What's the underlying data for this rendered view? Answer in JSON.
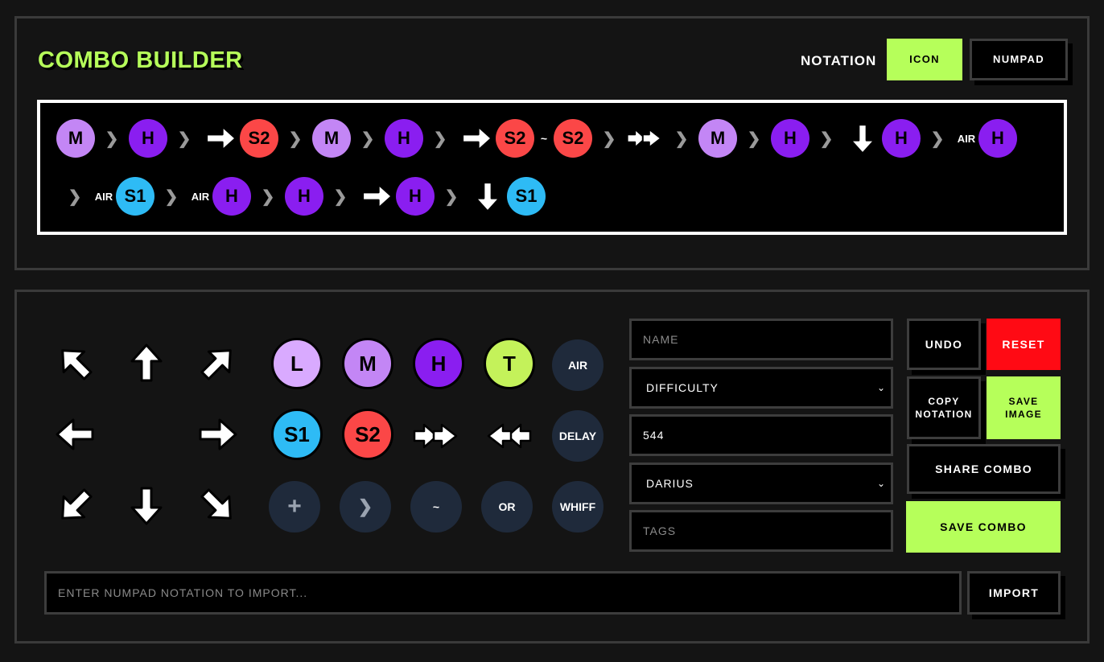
{
  "header": {
    "title": "COMBO BUILDER",
    "notation_label": "NOTATION",
    "notation_options": [
      "ICON",
      "NUMPAD"
    ],
    "notation_selected": "ICON"
  },
  "colors": {
    "accent": "#b6ff5a",
    "reset": "#ff0a14",
    "light": "#d9aaff",
    "medium": "#c386f5",
    "heavy": "#8a1ef0",
    "special1": "#2ebbf5",
    "special2": "#fb4747",
    "tag": "#c4f25a",
    "modifier_bg": "#1f2a3b"
  },
  "combo": {
    "row1": [
      {
        "t": "btn",
        "v": "M"
      },
      {
        "t": "sep",
        "v": "❯"
      },
      {
        "t": "btn",
        "v": "H"
      },
      {
        "t": "sep",
        "v": "❯"
      },
      {
        "t": "dir",
        "v": "right"
      },
      {
        "t": "btn",
        "v": "S2"
      },
      {
        "t": "sep",
        "v": "❯"
      },
      {
        "t": "btn",
        "v": "M"
      },
      {
        "t": "sep",
        "v": "❯"
      },
      {
        "t": "btn",
        "v": "H"
      },
      {
        "t": "sep",
        "v": "❯"
      },
      {
        "t": "dir",
        "v": "right"
      },
      {
        "t": "btn",
        "v": "S2"
      },
      {
        "t": "tilde",
        "v": "~"
      },
      {
        "t": "btn",
        "v": "S2"
      },
      {
        "t": "sep",
        "v": "❯"
      },
      {
        "t": "dir",
        "v": "dash-forward"
      },
      {
        "t": "sep",
        "v": "❯"
      },
      {
        "t": "btn",
        "v": "M"
      },
      {
        "t": "sep",
        "v": "❯"
      },
      {
        "t": "btn",
        "v": "H"
      },
      {
        "t": "sep",
        "v": "❯"
      },
      {
        "t": "dir",
        "v": "down"
      },
      {
        "t": "btn",
        "v": "H"
      },
      {
        "t": "sep",
        "v": "❯"
      },
      {
        "t": "air",
        "v": "AIR"
      },
      {
        "t": "btn",
        "v": "H"
      }
    ],
    "row2": [
      {
        "t": "sep",
        "v": "❯"
      },
      {
        "t": "air",
        "v": "AIR"
      },
      {
        "t": "btn",
        "v": "S1"
      },
      {
        "t": "sep",
        "v": "❯"
      },
      {
        "t": "air",
        "v": "AIR"
      },
      {
        "t": "btn",
        "v": "H"
      },
      {
        "t": "sep",
        "v": "❯"
      },
      {
        "t": "btn",
        "v": "H"
      },
      {
        "t": "sep",
        "v": "❯"
      },
      {
        "t": "dir",
        "v": "right"
      },
      {
        "t": "btn",
        "v": "H"
      },
      {
        "t": "sep",
        "v": "❯"
      },
      {
        "t": "dir",
        "v": "down"
      },
      {
        "t": "btn",
        "v": "S1"
      }
    ]
  },
  "palette": {
    "directions": [
      "up-left-arrow-icon",
      "up-arrow-icon",
      "up-right-arrow-icon",
      "left-arrow-icon",
      "",
      "right-arrow-icon",
      "down-left-arrow-icon",
      "down-arrow-icon",
      "down-right-arrow-icon"
    ],
    "buttons": [
      "L",
      "M",
      "H",
      "T",
      "S1",
      "S2"
    ],
    "dash_forward_icon": "dash-forward-icon",
    "dash_back_icon": "dash-back-icon",
    "modifiers": {
      "air": "AIR",
      "delay": "DELAY",
      "plus": "+",
      "link": "❯",
      "cancel": "~",
      "or": "OR",
      "whiff": "WHIFF"
    }
  },
  "form": {
    "name_placeholder": "NAME",
    "difficulty_value": "DIFFICULTY",
    "damage_value": "544",
    "character_value": "DARIUS",
    "tags_placeholder": "TAGS",
    "import_placeholder": "ENTER NUMPAD NOTATION TO IMPORT..."
  },
  "actions": {
    "undo": "UNDO",
    "reset": "RESET",
    "copy_notation": "COPY NOTATION",
    "save_image": "SAVE IMAGE",
    "share_combo": "SHARE COMBO",
    "save_combo": "SAVE COMBO",
    "import": "IMPORT"
  }
}
